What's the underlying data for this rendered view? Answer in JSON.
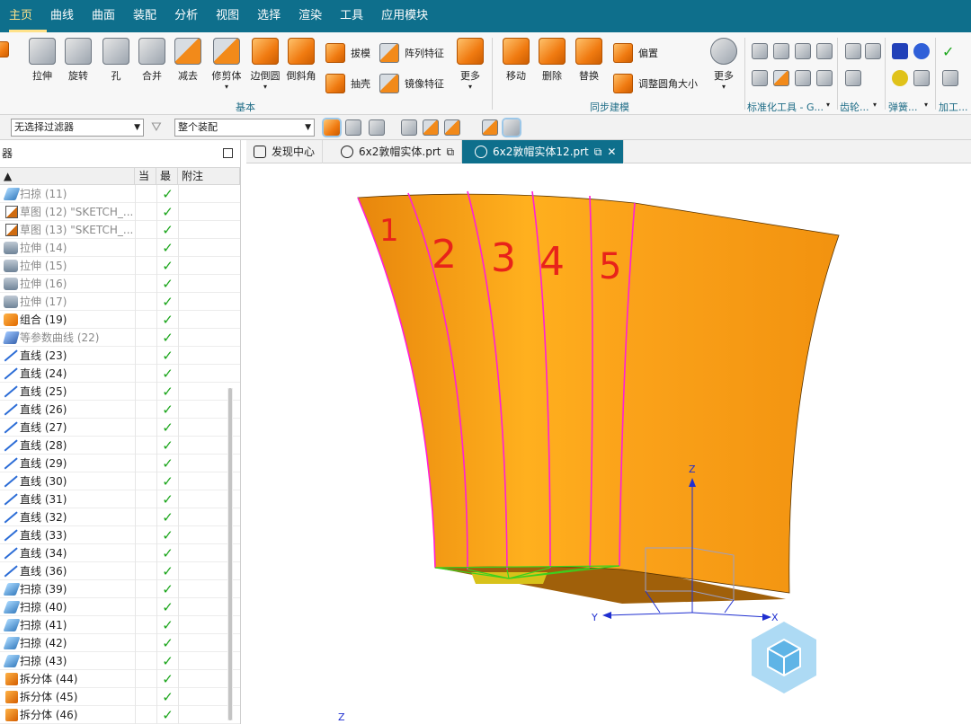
{
  "menu": {
    "tabs": [
      "主页",
      "曲线",
      "曲面",
      "装配",
      "分析",
      "视图",
      "选择",
      "渲染",
      "工具",
      "应用模块"
    ]
  },
  "ribbon": {
    "big_buttons": {
      "extrude": "拉伸",
      "revolve": "旋转",
      "hole": "孔",
      "unite": "合并",
      "subtract": "减去",
      "trim_body": "修剪体",
      "edge_blend": "边倒圆",
      "chamfer": "倒斜角",
      "more1": "更多",
      "move": "移动",
      "delete": "删除",
      "replace": "替换",
      "more2": "更多"
    },
    "small_buttons": {
      "draft": "拔模",
      "shell": "抽壳",
      "pattern_feature": "阵列特征",
      "mirror_feature": "镜像特征",
      "offset": "偏置",
      "resize_blend": "调整圆角大小"
    },
    "group_labels": {
      "basic": "基本",
      "sync": "同步建模",
      "std_tools": "标准化工具 - G...",
      "gear": "齿轮...",
      "spring": "弹簧...",
      "machining": "加工..."
    }
  },
  "filterbar": {
    "selection_filter": "无选择过滤器",
    "scope": "整个装配"
  },
  "navigator": {
    "title": "器",
    "columns": [
      "",
      "当",
      "最",
      "附注"
    ],
    "rows": [
      {
        "label": "扫掠 (11)",
        "icon": "sweep-icon",
        "dim": true
      },
      {
        "label": "草图 (12) \"SKETCH_...",
        "icon": "sketch-icon",
        "dim": true
      },
      {
        "label": "草图 (13) \"SKETCH_...",
        "icon": "sketch-icon",
        "dim": true
      },
      {
        "label": "拉伸 (14)",
        "icon": "extrude-icon",
        "dim": true
      },
      {
        "label": "拉伸 (15)",
        "icon": "extrude-icon",
        "dim": true
      },
      {
        "label": "拉伸 (16)",
        "icon": "extrude-icon",
        "dim": true
      },
      {
        "label": "拉伸 (17)",
        "icon": "extrude-icon",
        "dim": true
      },
      {
        "label": "组合 (19)",
        "icon": "unite-icon",
        "dim": false
      },
      {
        "label": "等参数曲线 (22)",
        "icon": "isoparametric-curve-icon",
        "dim": true
      },
      {
        "label": "直线 (23)",
        "icon": "line-icon",
        "dim": false
      },
      {
        "label": "直线 (24)",
        "icon": "line-icon",
        "dim": false
      },
      {
        "label": "直线 (25)",
        "icon": "line-icon",
        "dim": false
      },
      {
        "label": "直线 (26)",
        "icon": "line-icon",
        "dim": false
      },
      {
        "label": "直线 (27)",
        "icon": "line-icon",
        "dim": false
      },
      {
        "label": "直线 (28)",
        "icon": "line-icon",
        "dim": false
      },
      {
        "label": "直线 (29)",
        "icon": "line-icon",
        "dim": false
      },
      {
        "label": "直线 (30)",
        "icon": "line-icon",
        "dim": false
      },
      {
        "label": "直线 (31)",
        "icon": "line-icon",
        "dim": false
      },
      {
        "label": "直线 (32)",
        "icon": "line-icon",
        "dim": false
      },
      {
        "label": "直线 (33)",
        "icon": "line-icon",
        "dim": false
      },
      {
        "label": "直线 (34)",
        "icon": "line-icon",
        "dim": false
      },
      {
        "label": "直线 (36)",
        "icon": "line-icon",
        "dim": false
      },
      {
        "label": "扫掠 (39)",
        "icon": "sweep-icon",
        "dim": false
      },
      {
        "label": "扫掠 (40)",
        "icon": "sweep-icon",
        "dim": false
      },
      {
        "label": "扫掠 (41)",
        "icon": "sweep-icon",
        "dim": false
      },
      {
        "label": "扫掠 (42)",
        "icon": "sweep-icon",
        "dim": false
      },
      {
        "label": "扫掠 (43)",
        "icon": "sweep-icon",
        "dim": false
      },
      {
        "label": "拆分体 (44)",
        "icon": "split-body-icon",
        "dim": false
      },
      {
        "label": "拆分体 (45)",
        "icon": "split-body-icon",
        "dim": false
      },
      {
        "label": "拆分体 (46)",
        "icon": "split-body-icon",
        "dim": false
      }
    ],
    "checkmark": "✓"
  },
  "doc_tabs": [
    {
      "label": "发现中心",
      "active": false
    },
    {
      "label": "6x2敦帽实体.prt",
      "active": false
    },
    {
      "label": "6x2敦帽实体12.prt",
      "active": true
    }
  ],
  "viewport": {
    "annotations": [
      "1",
      "2",
      "3",
      "4",
      "5"
    ],
    "axis_labels": {
      "x": "X",
      "y": "Y",
      "z": "Z"
    },
    "colors": {
      "body": "#f59a16",
      "edge": "#ff1fd6",
      "annotation": "#e8231a",
      "triad": "#1f2fd0"
    }
  }
}
